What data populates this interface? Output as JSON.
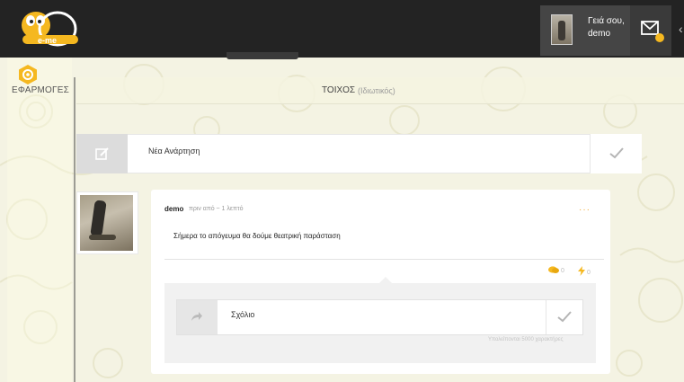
{
  "header": {
    "logo_text": "e-me",
    "greeting_line1": "Γειά σου,",
    "greeting_line2": "demo",
    "mail_icon": "envelope-icon",
    "edge_glyph": "‹"
  },
  "sidebar": {
    "apps_label": "ΕΦΑΡΜΟΓΕΣ",
    "apps_icon": "gear-icon"
  },
  "wall": {
    "title": "ΤΟΙΧΟΣ",
    "subtitle": "(Ιδιωτικός)"
  },
  "composer": {
    "placeholder": "Νέα Ανάρτηση",
    "icon": "edit-icon",
    "submit_icon": "check-icon"
  },
  "post": {
    "author": "demo",
    "time": "πριν από ~ 1 λεπτό",
    "menu": "···",
    "body": "Σήμερα το απόγευμα θα δούμε θεατρική παράσταση",
    "comment_count": "0",
    "like_count": "0"
  },
  "comment": {
    "placeholder": "Σχόλιο",
    "icon": "share-arrow-icon",
    "submit_icon": "check-icon",
    "remaining": "Υπολείπονται 5000 χαρακτήρες"
  },
  "colors": {
    "topbar": "#232323",
    "accent_yellow": "#f5b820",
    "background": "#f6f5e6"
  }
}
